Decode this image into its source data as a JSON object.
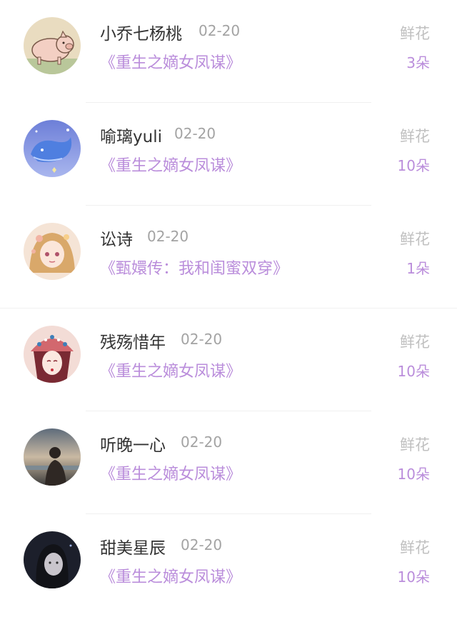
{
  "colors": {
    "accent": "#ba8ddb",
    "name": "#333333",
    "muted": "#a3a3a3"
  },
  "rows": [
    {
      "name": "小乔七杨桃",
      "date": "02-20",
      "book": "《重生之嫡女凤谋》",
      "gift_label": "鲜花",
      "gift_count": "3朵",
      "avatar_icon": "pig-avatar-icon"
    },
    {
      "name": "喻璃yuli",
      "date": "02-20",
      "book": "《重生之嫡女凤谋》",
      "gift_label": "鲜花",
      "gift_count": "10朵",
      "avatar_icon": "whale-avatar-icon"
    },
    {
      "name": "讼诗",
      "date": "02-20",
      "book": "《甄嬛传：我和闺蜜双穿》",
      "gift_label": "鲜花",
      "gift_count": "1朵",
      "avatar_icon": "anime-girl-avatar-icon"
    },
    {
      "name": "残殇惜年",
      "date": "02-20",
      "book": "《重生之嫡女凤谋》",
      "gift_label": "鲜花",
      "gift_count": "10朵",
      "avatar_icon": "opera-mask-avatar-icon"
    },
    {
      "name": "听晚一心",
      "date": "02-20",
      "book": "《重生之嫡女凤谋》",
      "gift_label": "鲜花",
      "gift_count": "10朵",
      "avatar_icon": "sunset-person-avatar-icon"
    },
    {
      "name": "甜美星辰",
      "date": "02-20",
      "book": "《重生之嫡女凤谋》",
      "gift_label": "鲜花",
      "gift_count": "10朵",
      "avatar_icon": "dark-portrait-avatar-icon"
    }
  ]
}
